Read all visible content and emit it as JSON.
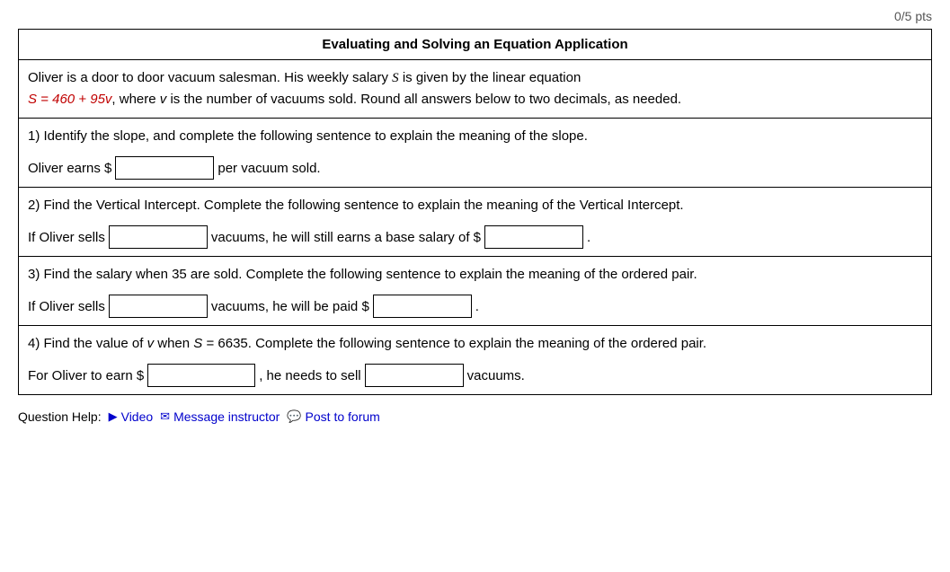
{
  "header": {
    "pts_text": "0/5 pts"
  },
  "title": "Evaluating and Solving an Equation Application",
  "problem_description": "Oliver is a door to door vacuum salesman. His weekly salary S is given by the linear equation S = 460 + 95v, where v is the number of vacuums sold. Round all answers below to two decimals, as needed.",
  "questions": [
    {
      "id": "q1",
      "label": "1) Identify the slope, and complete the following sentence to explain the meaning of the slope.",
      "answer_prefix": "Oliver earns $",
      "answer_suffix": "per vacuum sold.",
      "inputs": [
        {
          "id": "q1_input1",
          "placeholder": ""
        }
      ]
    },
    {
      "id": "q2",
      "label": "2) Find the Vertical Intercept. Complete the following sentence to explain the meaning of the Vertical Intercept.",
      "answer_prefix": "If Oliver sells",
      "answer_middle": "vacuums, he will still earns a base salary of $",
      "answer_suffix": ".",
      "inputs": [
        {
          "id": "q2_input1",
          "placeholder": ""
        },
        {
          "id": "q2_input2",
          "placeholder": ""
        }
      ]
    },
    {
      "id": "q3",
      "label": "3) Find the salary when 35 are sold. Complete the following sentence to explain the meaning of the ordered pair.",
      "answer_prefix": "If Oliver sells",
      "answer_middle": "vacuums, he will be paid $",
      "answer_suffix": ".",
      "inputs": [
        {
          "id": "q3_input1",
          "placeholder": ""
        },
        {
          "id": "q3_input2",
          "placeholder": ""
        }
      ]
    },
    {
      "id": "q4",
      "label_part1": "4) Find the value of v when S = 6635. Complete the following sentence to explain the meaning of the ordered pair.",
      "answer_prefix": "For Oliver to earn $",
      "answer_middle": ", he needs to sell",
      "answer_suffix": "vacuums.",
      "inputs": [
        {
          "id": "q4_input1",
          "placeholder": ""
        },
        {
          "id": "q4_input2",
          "placeholder": ""
        }
      ]
    }
  ],
  "footer": {
    "label": "Question Help:",
    "video_label": "Video",
    "message_label": "Message instructor",
    "forum_label": "Post to forum"
  }
}
